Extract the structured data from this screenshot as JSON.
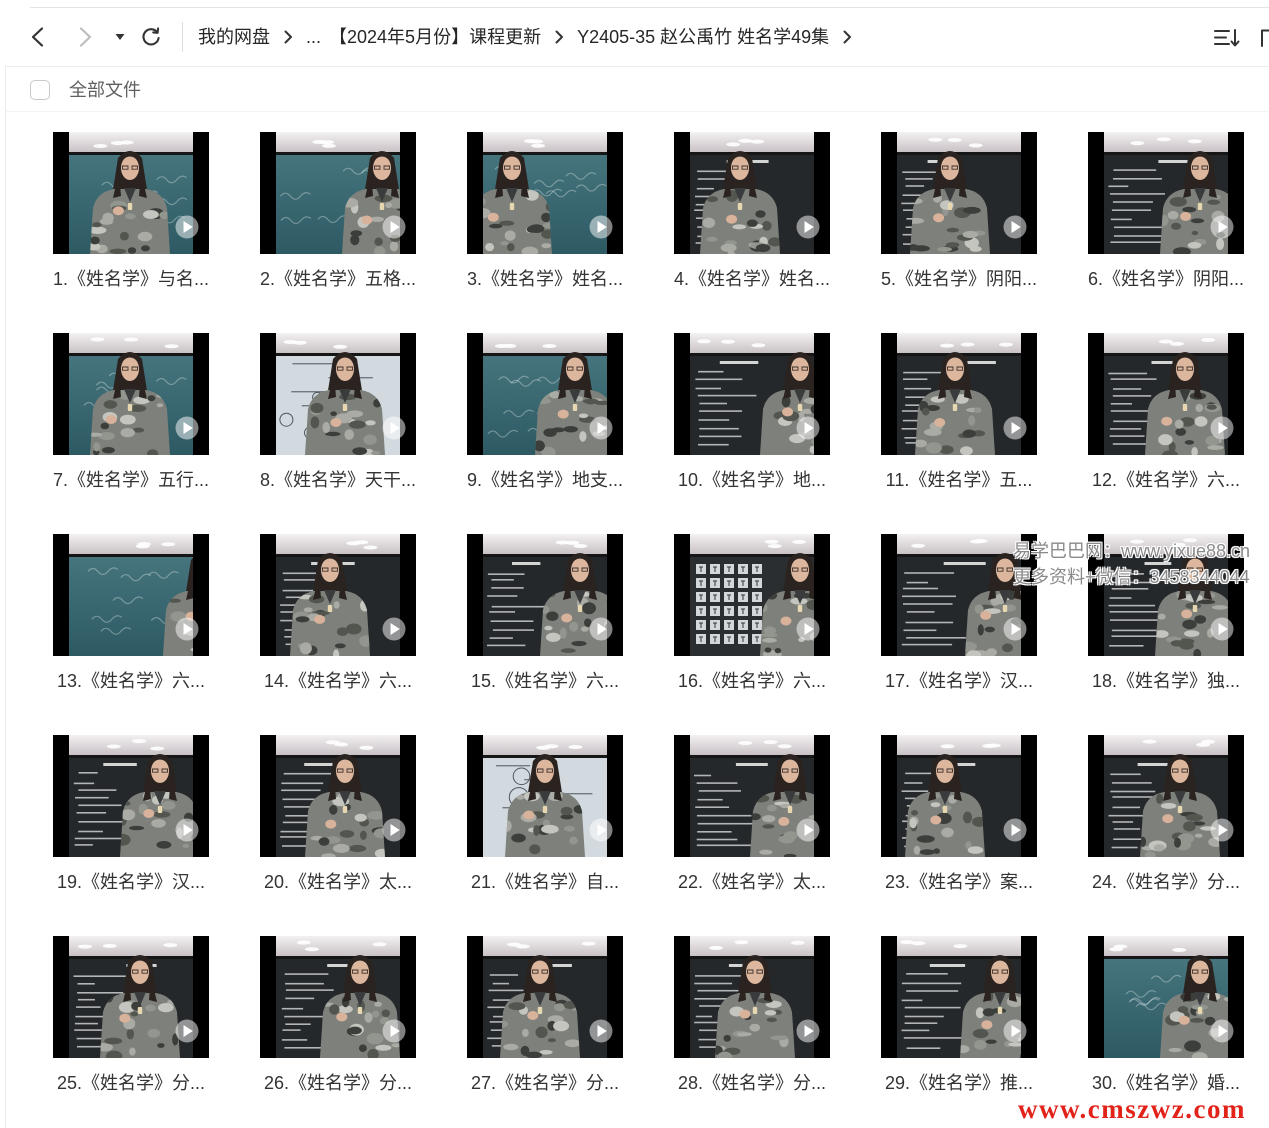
{
  "toolbar": {
    "back_icon": "chevron-left-icon",
    "forward_icon": "chevron-right-icon",
    "history_icon": "caret-down-icon",
    "refresh_icon": "refresh-icon",
    "sort_icon": "sort-icon",
    "view_icon": "grid-view-icon"
  },
  "breadcrumb": {
    "root": "我的网盘",
    "ellipsis": "...",
    "parent": "【2024年5月份】课程更新",
    "current": "Y2405-35 赵公禹竹 姓名学49集",
    "separator_icon": "chevron-right-icon"
  },
  "list_header": {
    "select_all_label": "全部文件"
  },
  "file_overlay_icon": "play-icon",
  "files": [
    {
      "name": "1.《姓名学》与名..."
    },
    {
      "name": "2.《姓名学》五格..."
    },
    {
      "name": "3.《姓名学》姓名..."
    },
    {
      "name": "4.《姓名学》姓名..."
    },
    {
      "name": "5.《姓名学》阴阳..."
    },
    {
      "name": "6.《姓名学》阴阳..."
    },
    {
      "name": "7.《姓名学》五行..."
    },
    {
      "name": "8.《姓名学》天干..."
    },
    {
      "name": "9.《姓名学》地支..."
    },
    {
      "name": "10.《姓名学》地..."
    },
    {
      "name": "11.《姓名学》五..."
    },
    {
      "name": "12.《姓名学》六..."
    },
    {
      "name": "13.《姓名学》六..."
    },
    {
      "name": "14.《姓名学》六..."
    },
    {
      "name": "15.《姓名学》六..."
    },
    {
      "name": "16.《姓名学》六..."
    },
    {
      "name": "17.《姓名学》汉..."
    },
    {
      "name": "18.《姓名学》独..."
    },
    {
      "name": "19.《姓名学》汉..."
    },
    {
      "name": "20.《姓名学》太..."
    },
    {
      "name": "21.《姓名学》自..."
    },
    {
      "name": "22.《姓名学》太..."
    },
    {
      "name": "23.《姓名学》案..."
    },
    {
      "name": "24.《姓名学》分..."
    },
    {
      "name": "25.《姓名学》分..."
    },
    {
      "name": "26.《姓名学》分..."
    },
    {
      "name": "27.《姓名学》分..."
    },
    {
      "name": "28.《姓名学》分..."
    },
    {
      "name": "29.《姓名学》推..."
    },
    {
      "name": "30.《姓名学》婚..."
    }
  ],
  "watermarks": {
    "line1": "易学巴巴网：www.yixue88.cn",
    "line2": "更多资料+微信：3458344044",
    "footer": "www.cmszwz.com"
  },
  "colors": {
    "text": "#333333",
    "muted": "#5f5f5f",
    "disabled_icon": "#bdbdbd",
    "divider": "#ececec",
    "thumbnail_frame": "#000000",
    "watermark_red": "#e2231a"
  }
}
